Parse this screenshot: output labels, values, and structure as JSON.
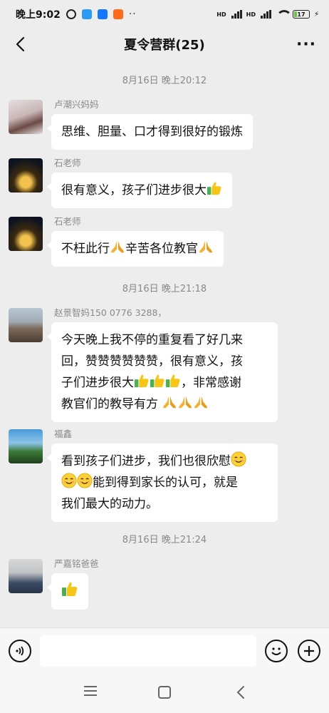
{
  "status_bar": {
    "time": "晚上9:02",
    "battery": "17",
    "more": "··"
  },
  "header": {
    "title": "夏令营群(25)"
  },
  "timestamps": [
    "8月16日 晚上20:12",
    "8月16日 晚上21:18",
    "8月16日 晚上21:24"
  ],
  "messages": [
    {
      "sender": "卢潮兴妈妈",
      "lines": [
        "思维、胆量、口才得到很好的锻炼"
      ],
      "avatar_icon": "woman-portrait"
    },
    {
      "sender": "石老师",
      "lines": [
        "很有意义，孩子们进步很大"
      ],
      "emojis": [
        "thumbs-up"
      ],
      "avatar_icon": "tower-night"
    },
    {
      "sender": "石老师",
      "lines": [
        "不枉此行",
        "辛苦各位教官"
      ],
      "emojis": [
        "folded-hands",
        "folded-hands"
      ],
      "avatar_icon": "tower-night"
    },
    {
      "sender": "赵景智妈150 0776 3288，",
      "lines": [
        "今天晚上我不停的重复看了好几来",
        "回，赞赞赞赞赞赞，很有意义，孩",
        "子们进步很大",
        "，非常感谢",
        "教官们的教导有方"
      ],
      "avatar_icon": "building-photo"
    },
    {
      "sender": "福鑫",
      "lines": [
        "看到孩子们进步，我们也很欣慰",
        "能到得到家长的认可，就是",
        "我们最大的动力。"
      ],
      "avatar_icon": "field-photo"
    },
    {
      "sender": "严嘉铭爸爸",
      "lines": [],
      "emojis": [
        "thumbs-up"
      ],
      "avatar_icon": "man-portrait"
    }
  ],
  "colors": {
    "background": "#ededed",
    "bubble": "#ffffff",
    "meta": "#888888",
    "thumb_green": "#4caf50",
    "thumb_yellow": "#f5c518",
    "hands_yellow": "#f3b233"
  }
}
